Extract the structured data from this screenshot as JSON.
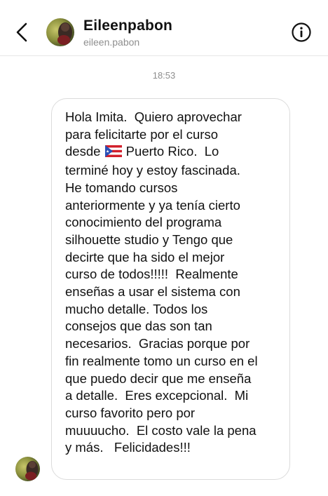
{
  "header": {
    "name": "Eileenpabon",
    "username": "eileen.pabon",
    "back_icon": "chevron-left-icon",
    "info_icon": "info-icon"
  },
  "conversation": {
    "timestamp": "18:53",
    "message": {
      "emoji": "puerto-rico-flag",
      "lines": [
        "Hola Imita.  Quiero aprovechar",
        "para felicitarte por el curso",
        [
          "desde ",
          " Puerto Rico.  Lo"
        ],
        "terminé hoy y estoy fascinada.",
        "He tomando cursos",
        "anteriormente y ya tenía cierto",
        "conocimiento del programa",
        "silhouette studio y Tengo que",
        "decirte que ha sido el mejor",
        "curso de todos!!!!!  Realmente",
        "enseñas a usar el sistema con",
        "mucho detalle. Todos los",
        "consejos que das son tan",
        "necesarios.  Gracias porque por",
        "fin realmente tomo un curso en el",
        "que puedo decir que me enseña",
        "a detalle.  Eres excepcional.  Mi",
        "curso favorito pero por",
        "muuuucho.  El costo vale la pena",
        "y más.   Felicidades!!!"
      ]
    }
  },
  "colors": {
    "bubble_border": "#dbdbdb",
    "secondary_text": "#8e8e8e",
    "divider": "#e6e6e6"
  }
}
